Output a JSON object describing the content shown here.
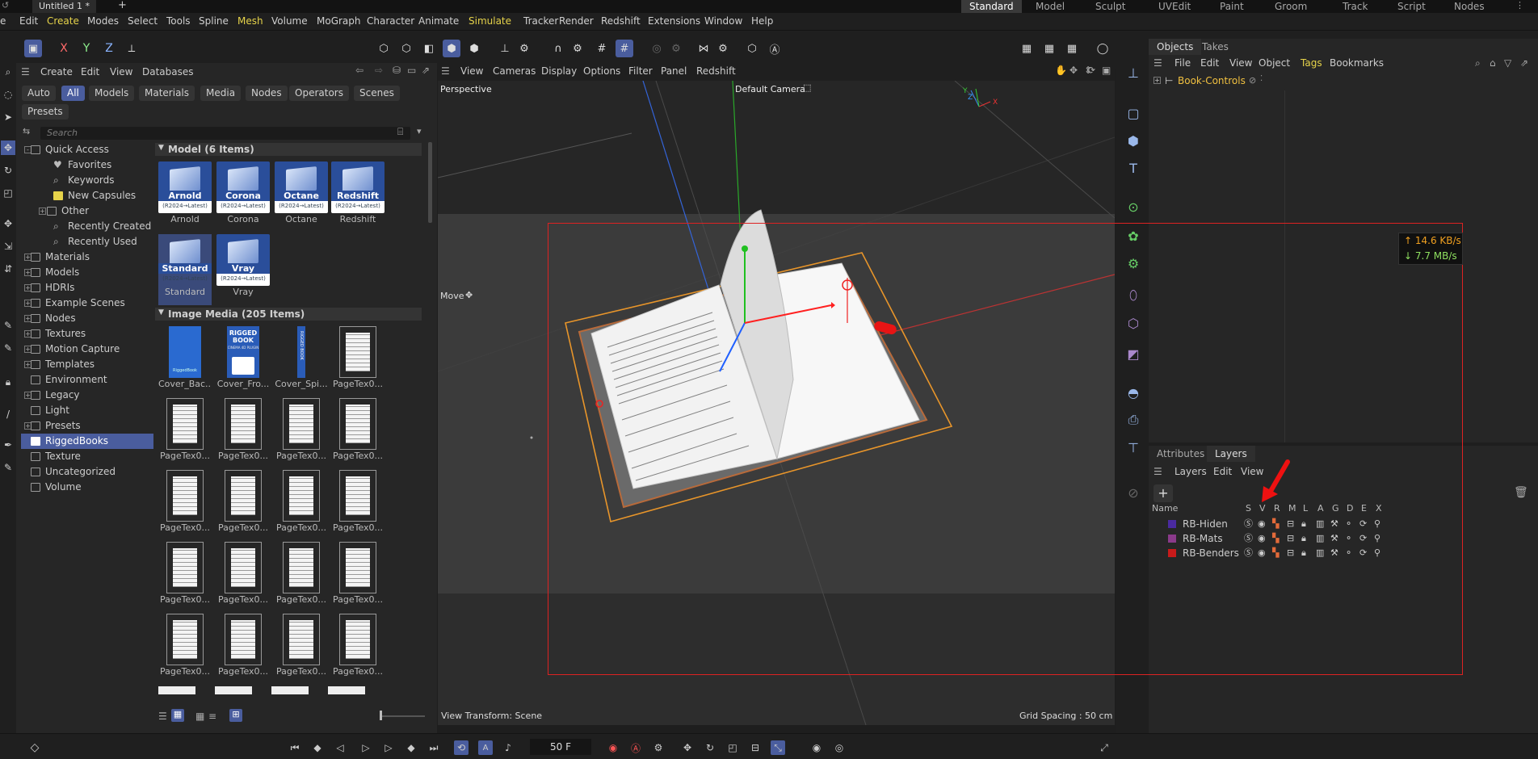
{
  "window": {
    "doc_tab": "Untitled 1 *",
    "new_tab_symbol": "+"
  },
  "layouts": [
    "Standard",
    "Model",
    "Sculpt",
    "UVEdit",
    "Paint",
    "Groom",
    "Track",
    "Script",
    "Nodes"
  ],
  "menubar": [
    "e",
    "Edit",
    "Create",
    "Modes",
    "Select",
    "Tools",
    "Spline",
    "Mesh",
    "Volume",
    "MoGraph",
    "Character",
    "Animate",
    "Simulate",
    "Tracker",
    "Render",
    "Redshift",
    "Extensions",
    "Window",
    "Help"
  ],
  "asset_browser": {
    "menu": [
      "Create",
      "Edit",
      "View",
      "Databases"
    ],
    "filters": [
      "Auto",
      "All",
      "Models",
      "Materials",
      "Media",
      "Nodes",
      "Operators",
      "Scenes"
    ],
    "presets_chip": "Presets",
    "search_placeholder": "Search",
    "tree": [
      {
        "label": "Quick Access",
        "expander": "-",
        "indent": 0,
        "type": "folder"
      },
      {
        "label": "Favorites",
        "indent": 1,
        "type": "heart"
      },
      {
        "label": "Keywords",
        "indent": 1,
        "type": "search"
      },
      {
        "label": "New Capsules",
        "indent": 1,
        "type": "capsule"
      },
      {
        "label": "Other",
        "expander": "+",
        "indent": 1,
        "type": "folder"
      },
      {
        "label": "Recently Created",
        "indent": 1,
        "type": "search"
      },
      {
        "label": "Recently Used",
        "indent": 1,
        "type": "search"
      },
      {
        "label": "Materials",
        "expander": "+",
        "indent": 0,
        "type": "folder"
      },
      {
        "label": "Models",
        "expander": "+",
        "indent": 0,
        "type": "folder"
      },
      {
        "label": "HDRIs",
        "expander": "+",
        "indent": 0,
        "type": "folder"
      },
      {
        "label": "Example Scenes",
        "expander": "+",
        "indent": 0,
        "type": "folder"
      },
      {
        "label": "Nodes",
        "expander": "+",
        "indent": 0,
        "type": "folder"
      },
      {
        "label": "Textures",
        "expander": "+",
        "indent": 0,
        "type": "folder"
      },
      {
        "label": "Motion Capture",
        "expander": "+",
        "indent": 0,
        "type": "folder"
      },
      {
        "label": "Templates",
        "expander": "+",
        "indent": 0,
        "type": "folder"
      },
      {
        "label": "Environment",
        "indent": 0,
        "type": "folder"
      },
      {
        "label": "Legacy",
        "expander": "+",
        "indent": 0,
        "type": "folder"
      },
      {
        "label": "Light",
        "indent": 0,
        "type": "folder"
      },
      {
        "label": "Presets",
        "expander": "+",
        "indent": 0,
        "type": "folder"
      },
      {
        "label": "RiggedBooks",
        "indent": 0,
        "type": "folder",
        "selected": true
      },
      {
        "label": "Texture",
        "indent": 0,
        "type": "folder"
      },
      {
        "label": "Uncategorized",
        "indent": 0,
        "type": "folder"
      },
      {
        "label": "Volume",
        "indent": 0,
        "type": "folder"
      }
    ],
    "model_section": "Model (6 Items)",
    "models": [
      {
        "name": "Arnold",
        "label": "Arnold",
        "ver": "(R2024→Latest)"
      },
      {
        "name": "Corona",
        "label": "Corona",
        "ver": "(R2024→Latest)"
      },
      {
        "name": "Octane",
        "label": "Octane",
        "ver": "(R2024→Latest)"
      },
      {
        "name": "Redshift",
        "label": "Redshift",
        "ver": "(R2024→Latest)"
      },
      {
        "name": "Standard",
        "label": "Standard",
        "ver": "(R2024→Latest)",
        "selected": true
      },
      {
        "name": "Vray",
        "label": "Vray",
        "ver": "(R2024→Latest)"
      }
    ],
    "media_section": "Image Media (205 Items)",
    "media": [
      {
        "label": "Cover_Bac...",
        "kind": "cover_back",
        "cover_text": "RiggedBook"
      },
      {
        "label": "Cover_Fro...",
        "kind": "cover_front",
        "cover_title": "RIGGED BOOK",
        "cover_sub": "CINEMA 4D PLUGIN"
      },
      {
        "label": "Cover_Spi...",
        "kind": "spine",
        "spine_text": "RIGGED BOOK"
      },
      {
        "label": "PageTex0...",
        "kind": "page"
      },
      {
        "label": "PageTex0...",
        "kind": "page"
      },
      {
        "label": "PageTex0...",
        "kind": "page"
      },
      {
        "label": "PageTex0...",
        "kind": "page"
      },
      {
        "label": "PageTex0...",
        "kind": "page"
      },
      {
        "label": "PageTex0...",
        "kind": "page"
      },
      {
        "label": "PageTex0...",
        "kind": "page"
      },
      {
        "label": "PageTex0...",
        "kind": "page"
      },
      {
        "label": "PageTex0...",
        "kind": "page"
      },
      {
        "label": "PageTex0...",
        "kind": "page"
      },
      {
        "label": "PageTex0...",
        "kind": "page"
      },
      {
        "label": "PageTex0...",
        "kind": "page"
      },
      {
        "label": "PageTex0...",
        "kind": "page"
      },
      {
        "label": "PageTex0...",
        "kind": "page"
      },
      {
        "label": "PageTex0...",
        "kind": "page"
      },
      {
        "label": "PageTex0...",
        "kind": "page"
      },
      {
        "label": "PageTex0...",
        "kind": "page"
      }
    ]
  },
  "viewport": {
    "menu": [
      "View",
      "Cameras",
      "Display",
      "Options",
      "Filter",
      "Panel",
      "Redshift"
    ],
    "projection": "Perspective",
    "camera": "Default Camera",
    "tool": "Move",
    "view_transform": "View Transform: Scene",
    "grid_spacing": "Grid Spacing : 50 cm",
    "axis_labels": {
      "y": "Y",
      "z": "Z",
      "x": "X"
    }
  },
  "objects_panel": {
    "tabs": [
      "Objects",
      "Takes"
    ],
    "menu": [
      "File",
      "Edit",
      "View",
      "Object",
      "Tags",
      "Bookmarks"
    ],
    "object": "Book-Controls"
  },
  "layers_panel": {
    "tabs": [
      "Attributes",
      "Layers"
    ],
    "menu": [
      "Layers",
      "Edit",
      "View"
    ],
    "columns": [
      "Name",
      "S",
      "V",
      "R",
      "M",
      "L",
      "A",
      "G",
      "D",
      "E",
      "X"
    ],
    "layers": [
      {
        "name": "RB-Hiden",
        "color": "#4a2aa0"
      },
      {
        "name": "RB-Mats",
        "color": "#8a3a8a"
      },
      {
        "name": "RB-Benders",
        "color": "#c81a1a"
      }
    ]
  },
  "network": {
    "up": "↑ 14.6 KB/s",
    "down": "↓ 7.7 MB/s"
  },
  "timeline": {
    "frame": "50 F"
  },
  "colors": {
    "accent": "#4a5d9e",
    "highlight_menu": "#e6d34a",
    "annotation": "#dd2222"
  }
}
